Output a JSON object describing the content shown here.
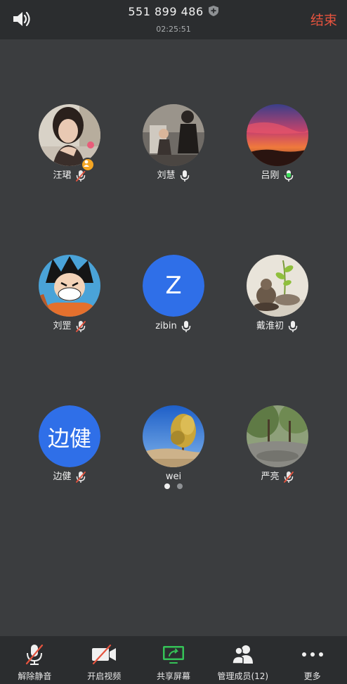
{
  "header": {
    "meeting_id": "551 899 486",
    "timer": "02:25:51",
    "end_label": "结束"
  },
  "participants": [
    {
      "name": "汪珺",
      "mic": "muted",
      "host": true,
      "avatar": "photo-woman"
    },
    {
      "name": "刘慧",
      "mic": "on",
      "avatar": "photo-family"
    },
    {
      "name": "吕刚",
      "mic": "speaking",
      "avatar": "photo-sunset"
    },
    {
      "name": "刘罡",
      "mic": "muted",
      "avatar": "photo-cartoon"
    },
    {
      "name": "zibin",
      "mic": "on",
      "avatar": "letter",
      "letter": "Z"
    },
    {
      "name": "戴淮初",
      "mic": "on",
      "avatar": "photo-figurine"
    },
    {
      "name": "边健",
      "mic": "muted",
      "avatar": "letter",
      "letter": "边健"
    },
    {
      "name": "wei",
      "mic": "none",
      "avatar": "photo-tree"
    },
    {
      "name": "严亮",
      "mic": "muted",
      "avatar": "photo-park"
    }
  ],
  "pager": {
    "pages": 2,
    "current": 1
  },
  "toolbar": {
    "unmute": "解除静音",
    "start_video": "开启视频",
    "share_screen": "共享屏幕",
    "manage_members": "管理成员(12)",
    "more": "更多"
  },
  "colors": {
    "background": "#3b3d3f",
    "bar": "#2b2d2f",
    "end": "#e5533e",
    "speaking": "#3ddc5a",
    "muted_slash": "#e5533e",
    "letter_avatar": "#2f6fe8",
    "share_icon": "#35c257"
  }
}
